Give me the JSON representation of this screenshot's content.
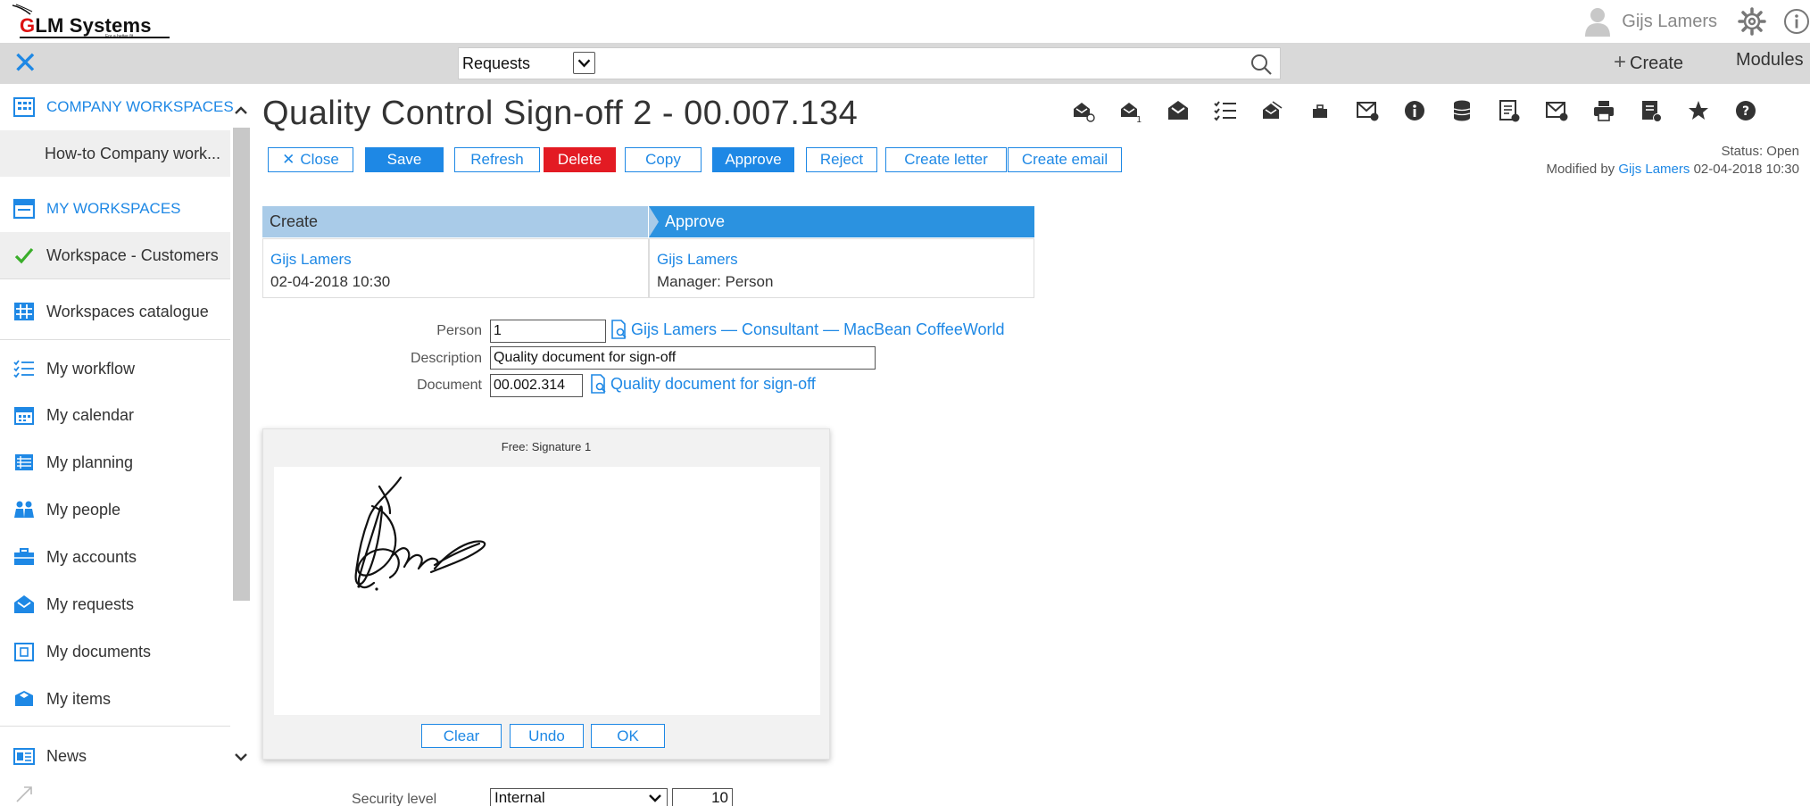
{
  "header": {
    "logo_text": "GLM Systems",
    "logo_tagline": "For a better fit",
    "user_name": "Gijs Lamers"
  },
  "searchbar": {
    "select_value": "Requests",
    "create_label": "Create",
    "modules_label": "Modules"
  },
  "sidebar": {
    "items": [
      {
        "label": "COMPANY WORKSPACES",
        "icon": "company-workspaces-icon"
      },
      {
        "label": "How-to Company work...",
        "icon": ""
      },
      {
        "label": "MY WORKSPACES",
        "icon": "my-workspaces-icon"
      },
      {
        "label": "Workspace - Customers",
        "icon": "checkmark-icon"
      },
      {
        "label": "Workspaces catalogue",
        "icon": "grid-icon"
      },
      {
        "label": "My workflow",
        "icon": "workflow-list-icon"
      },
      {
        "label": "My calendar",
        "icon": "calendar-icon"
      },
      {
        "label": "My planning",
        "icon": "planning-icon"
      },
      {
        "label": "My people",
        "icon": "people-icon"
      },
      {
        "label": "My accounts",
        "icon": "briefcase-icon"
      },
      {
        "label": "My requests",
        "icon": "open-envelope-icon"
      },
      {
        "label": "My documents",
        "icon": "document-icon"
      },
      {
        "label": "My items",
        "icon": "box-icon"
      },
      {
        "label": "News",
        "icon": "news-icon"
      }
    ]
  },
  "main": {
    "title": "Quality Control Sign-off 2 - 00.007.134",
    "buttons": {
      "close": "Close",
      "save": "Save",
      "refresh": "Refresh",
      "delete": "Delete",
      "copy": "Copy",
      "approve": "Approve",
      "reject": "Reject",
      "create_letter": "Create letter",
      "create_email": "Create email"
    },
    "status_line": "Status: Open",
    "modified_prefix": "Modified by",
    "modified_by": "Gijs Lamers",
    "modified_date": "02-04-2018 10:30"
  },
  "workflow": {
    "create_header": "Create",
    "approve_header": "Approve",
    "create_user": "Gijs Lamers",
    "create_date": "02-04-2018 10:30",
    "approve_user": "Gijs Lamers",
    "approve_role": "Manager: Person"
  },
  "form": {
    "person_label": "Person",
    "person_value": "1",
    "person_link": "Gijs Lamers — Consultant — MacBean CoffeeWorld",
    "description_label": "Description",
    "description_value": "Quality document for sign-off",
    "document_label": "Document",
    "document_value": "00.002.314",
    "document_link": "Quality document for sign-off",
    "security_label": "Security level",
    "security_value": "Internal",
    "security_number": "10"
  },
  "signature": {
    "title": "Free: Signature 1",
    "clear": "Clear",
    "undo": "Undo",
    "ok": "OK"
  },
  "colors": {
    "accent": "#1e88e5",
    "danger": "#e31b23",
    "toolbar_bg": "#d9d9d9",
    "wf_create": "#a9cbe8",
    "wf_approve": "#2b92e0"
  }
}
